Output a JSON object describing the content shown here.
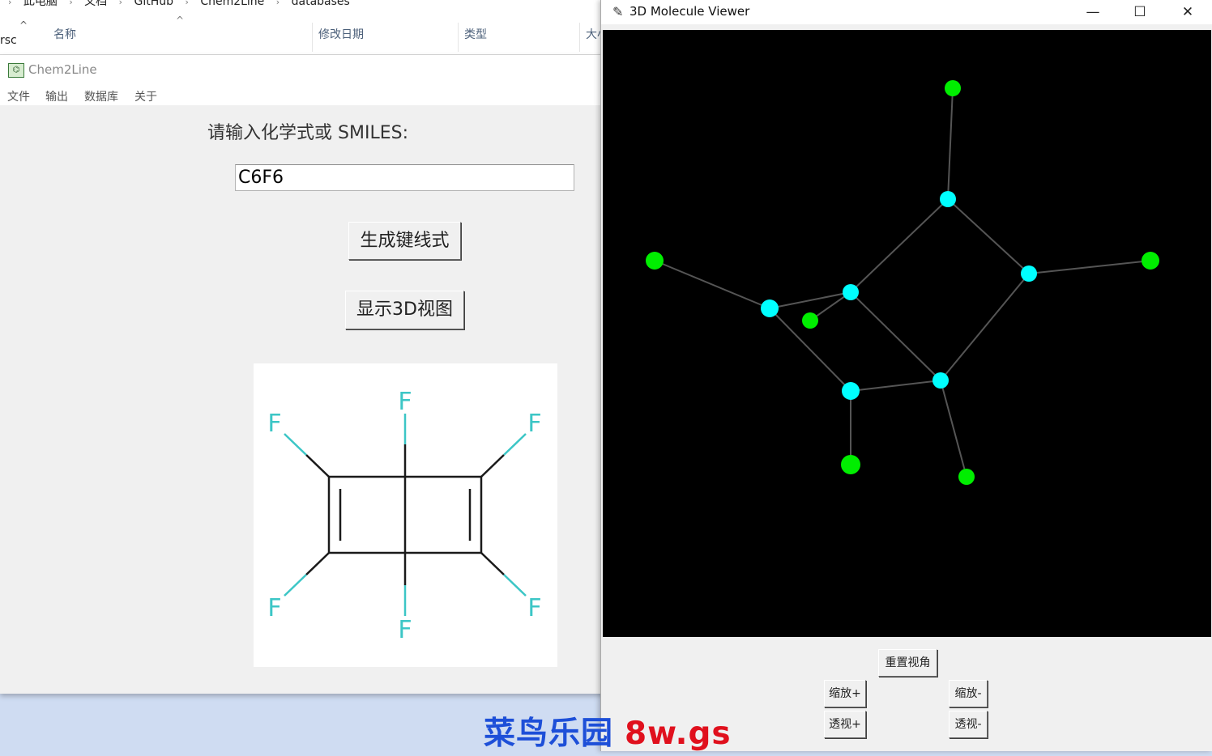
{
  "explorer": {
    "breadcrumb": [
      "此电脑",
      "文档",
      "GitHub",
      "Chem2Line",
      "databases"
    ],
    "side_label": "rsc",
    "columns": [
      "名称",
      "修改日期",
      "类型",
      "大小"
    ]
  },
  "chem_window": {
    "title": "Chem2Line",
    "icon": "app-icon",
    "menu": [
      "文件",
      "输出",
      "数据库",
      "关于"
    ],
    "prompt": "请输入化学式或 SMILES:",
    "formula_value": "C6F6",
    "generate_button": "生成键线式",
    "show3d_button": "显示3D视图",
    "structure": {
      "atom_label": "F",
      "atom_color": "#3cc6c6",
      "bond_color": "#1a1a1a"
    }
  },
  "viewer_window": {
    "title": "3D Molecule Viewer",
    "icon": "feather-icon",
    "controls": {
      "minimize": "—",
      "maximize": "☐",
      "close": "✕"
    },
    "carbon_color": "#00ffff",
    "fluorine_color": "#00ee00",
    "buttons": {
      "reset": "重置视角",
      "zoom_in": "缩放+",
      "zoom_out": "缩放-",
      "persp_in": "透视+",
      "persp_out": "透视-"
    }
  },
  "watermark": {
    "cn": "菜鸟乐园",
    "site": "8w.gs"
  }
}
